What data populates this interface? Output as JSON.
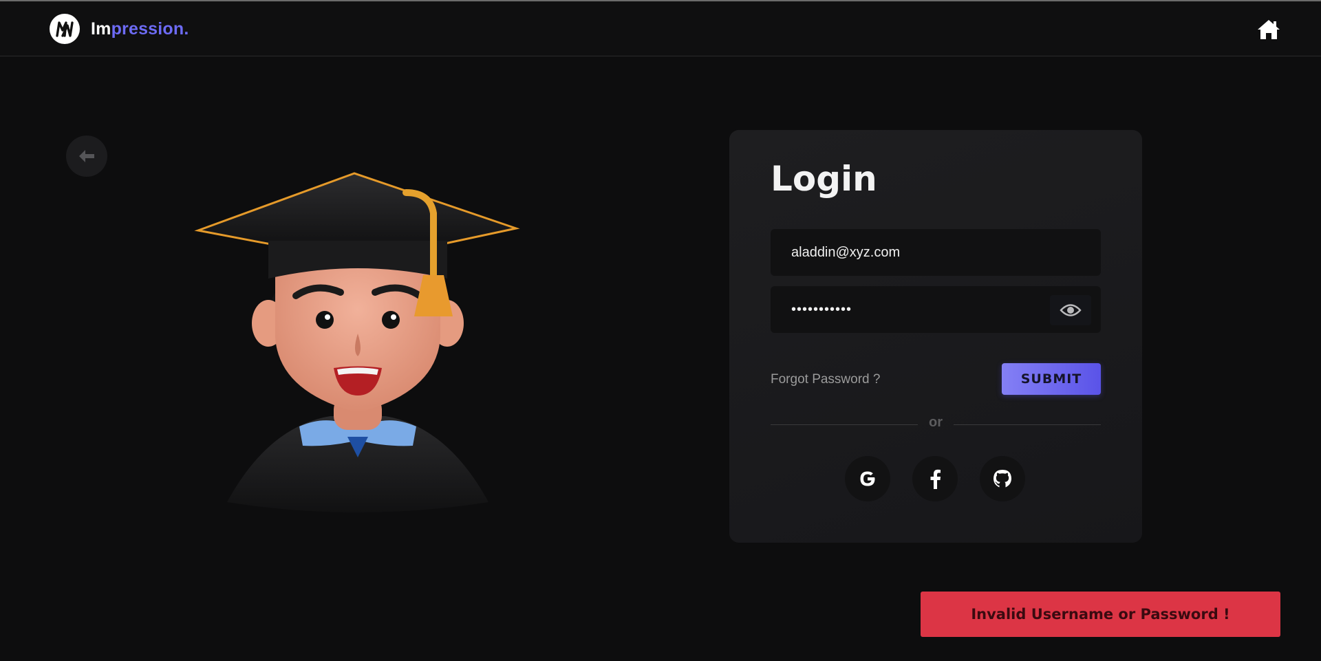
{
  "brand": {
    "part1": "Im",
    "part2": "pression."
  },
  "login": {
    "title": "Login",
    "email_value": "aladdin@xyz.com",
    "password_value": "•••••••••••",
    "forgot_label": "Forgot Password ?",
    "submit_label": "SUBMIT",
    "divider_text": "or"
  },
  "icons": {
    "home": "home-icon",
    "back": "arrow-left-icon",
    "eye": "eye-icon",
    "social": [
      "google-icon",
      "facebook-icon",
      "github-icon"
    ]
  },
  "toast": {
    "message": "Invalid Username or Password !"
  },
  "colors": {
    "accent": "#6d6bf5",
    "submit_gradient_start": "#8480f5",
    "submit_gradient_end": "#5a53e8",
    "error": "#dc3545",
    "background": "#0d0d0e",
    "card": "#1e1e20"
  }
}
